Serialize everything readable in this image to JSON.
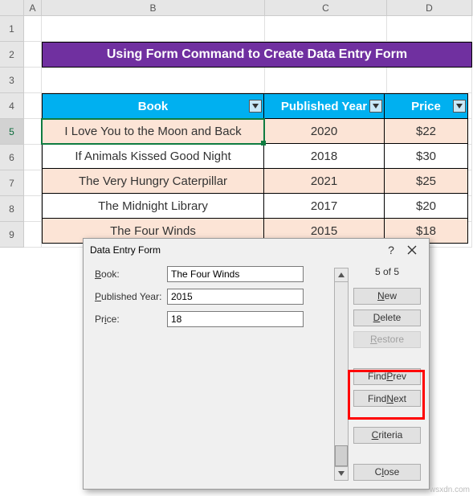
{
  "columns": {
    "A": "A",
    "B": "B",
    "C": "C",
    "D": "D"
  },
  "rows": {
    "r1": "1",
    "r2": "2",
    "r3": "3",
    "r4": "4",
    "r5": "5",
    "r6": "6",
    "r7": "7",
    "r8": "8",
    "r9": "9"
  },
  "title": "Using Form Command to Create Data Entry Form",
  "headers": {
    "book": "Book",
    "year": "Published Year",
    "price": "Price"
  },
  "data": [
    {
      "book": "I Love You to the Moon and Back",
      "year": "2020",
      "price": "$22"
    },
    {
      "book": "If Animals Kissed Good Night",
      "year": "2018",
      "price": "$30"
    },
    {
      "book": "The Very Hungry Caterpillar",
      "year": "2021",
      "price": "$25"
    },
    {
      "book": "The Midnight Library",
      "year": "2017",
      "price": "$20"
    },
    {
      "book": "The Four Winds",
      "year": "2015",
      "price": "$18"
    }
  ],
  "dialog": {
    "title": "Data Entry Form",
    "counter": "5 of 5",
    "labels": {
      "book_pre": "B",
      "book_post": "ook:",
      "year_pre": "P",
      "year_post": "ublished Year:",
      "price_pre": "Pr",
      "price_u": "i",
      "price_post": "ce:"
    },
    "values": {
      "book": "The Four Winds",
      "year": "2015",
      "price": "18"
    },
    "buttons": {
      "new_u": "N",
      "new_post": "ew",
      "delete_u": "D",
      "delete_post": "elete",
      "restore_u": "R",
      "restore_post": "estore",
      "findprev_pre": "Find ",
      "findprev_u": "P",
      "findprev_post": "rev",
      "findnext_pre": "Find ",
      "findnext_u": "N",
      "findnext_post": "ext",
      "criteria_u": "C",
      "criteria_post": "riteria",
      "close_pre": "C",
      "close_u": "l",
      "close_post": "ose"
    }
  },
  "watermark": "wsxdn.com"
}
